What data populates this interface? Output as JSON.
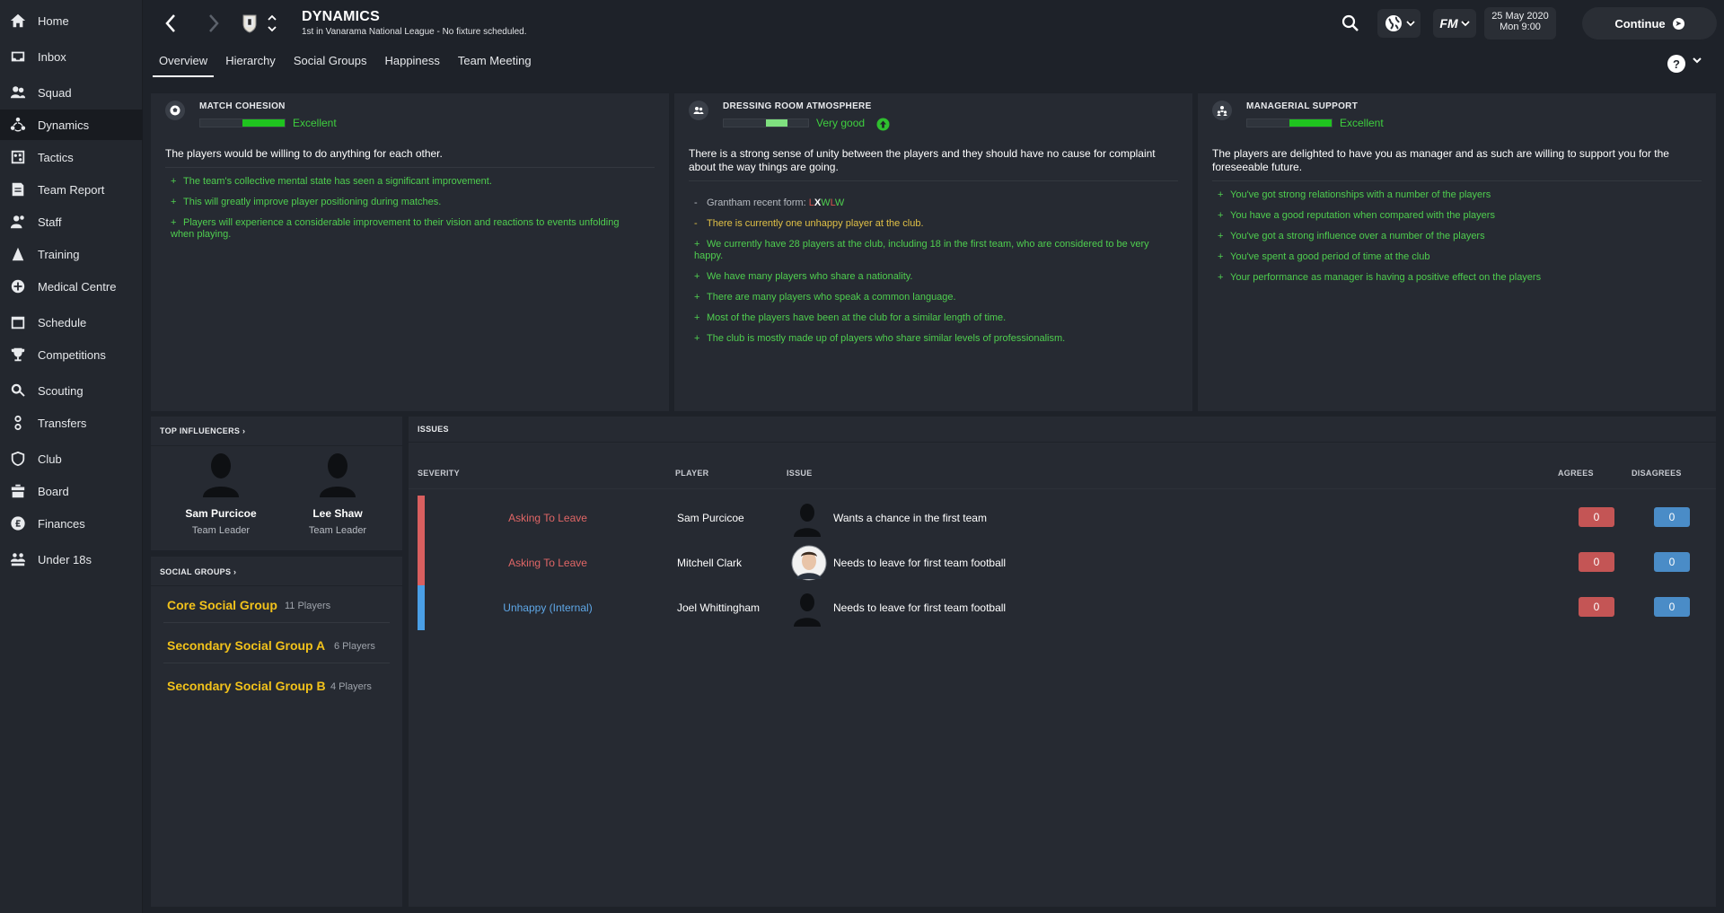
{
  "sidebar": {
    "items": [
      {
        "label": "Home",
        "icon": "home-icon",
        "active": false
      },
      {
        "label": "Inbox",
        "icon": "inbox-icon",
        "active": false
      },
      {
        "label": "Squad",
        "icon": "squad-icon",
        "active": false
      },
      {
        "label": "Dynamics",
        "icon": "dynamics-icon",
        "active": true
      },
      {
        "label": "Tactics",
        "icon": "tactics-icon",
        "active": false
      },
      {
        "label": "Team Report",
        "icon": "team-report-icon",
        "active": false
      },
      {
        "label": "Staff",
        "icon": "staff-icon",
        "active": false
      },
      {
        "label": "Training",
        "icon": "training-icon",
        "active": false
      },
      {
        "label": "Medical Centre",
        "icon": "medical-icon",
        "active": false
      },
      {
        "label": "Schedule",
        "icon": "schedule-icon",
        "active": false
      },
      {
        "label": "Competitions",
        "icon": "trophy-icon",
        "active": false
      },
      {
        "label": "Scouting",
        "icon": "search-icon",
        "active": false
      },
      {
        "label": "Transfers",
        "icon": "transfers-icon",
        "active": false
      },
      {
        "label": "Club",
        "icon": "club-shield-icon",
        "active": false
      },
      {
        "label": "Board",
        "icon": "board-icon",
        "active": false
      },
      {
        "label": "Finances",
        "icon": "finances-icon",
        "active": false
      },
      {
        "label": "Under 18s",
        "icon": "youth-icon",
        "active": false
      }
    ]
  },
  "header": {
    "title": "DYNAMICS",
    "subtitle": "1st in Vanarama National League - No fixture scheduled.",
    "fm_label": "FM",
    "date": "25 May 2020",
    "day_time": "Mon 9:00",
    "continue_label": "Continue"
  },
  "tabs": [
    {
      "label": "Overview",
      "active": true
    },
    {
      "label": "Hierarchy",
      "active": false
    },
    {
      "label": "Social Groups",
      "active": false
    },
    {
      "label": "Happiness",
      "active": false
    },
    {
      "label": "Team Meeting",
      "active": false
    }
  ],
  "help_label": "?",
  "cards": {
    "cohesion": {
      "title": "MATCH COHESION",
      "rating": "Excellent",
      "summary": "The players would be willing to do anything for each other.",
      "factors": [
        {
          "sym": "+",
          "text": "The team's collective mental state has seen a significant improvement.",
          "type": "pos"
        },
        {
          "sym": "+",
          "text": "This will greatly improve player positioning during matches.",
          "type": "pos"
        },
        {
          "sym": "+",
          "text": "Players will experience a considerable improvement to their vision and reactions to events unfolding when playing.",
          "type": "pos"
        }
      ]
    },
    "atmosphere": {
      "title": "DRESSING ROOM ATMOSPHERE",
      "rating": "Very good",
      "summary": "There is a strong sense of unity between the players and they should have no cause for complaint about the way things are going.",
      "form_label": "Grantham recent form: ",
      "form": [
        {
          "r": "L",
          "color": "#d9534f"
        },
        {
          "r": "X",
          "color": "#ffffff"
        },
        {
          "r": "W",
          "color": "#4fce4f"
        },
        {
          "r": "L",
          "color": "#d9534f"
        },
        {
          "r": "W",
          "color": "#4fce4f"
        }
      ],
      "factors": [
        {
          "sym": "-",
          "text": "There is currently one unhappy player at the club.",
          "type": "neg"
        },
        {
          "sym": "+",
          "text": "We currently have 28 players at the club, including 18 in the first team, who are considered to be very happy.",
          "type": "pos"
        },
        {
          "sym": "+",
          "text": "We have many players who share a nationality.",
          "type": "pos"
        },
        {
          "sym": "+",
          "text": "There are many players who speak a common language.",
          "type": "pos"
        },
        {
          "sym": "+",
          "text": "Most of the players have been at the club for a similar length of time.",
          "type": "pos"
        },
        {
          "sym": "+",
          "text": "The club is mostly made up of players who share similar levels of professionalism.",
          "type": "pos"
        }
      ]
    },
    "support": {
      "title": "MANAGERIAL SUPPORT",
      "rating": "Excellent",
      "summary": "The players are delighted to have you as manager and as such are willing to support you for the foreseeable future.",
      "factors": [
        {
          "sym": "+",
          "text": "You've got strong relationships with a number of the players",
          "type": "pos"
        },
        {
          "sym": "+",
          "text": "You have a good reputation when compared with the players",
          "type": "pos"
        },
        {
          "sym": "+",
          "text": "You've got a strong influence over a number of the players",
          "type": "pos"
        },
        {
          "sym": "+",
          "text": "You've spent a good period of time at the club",
          "type": "pos"
        },
        {
          "sym": "+",
          "text": "Your performance as manager is having a positive effect on the players",
          "type": "pos"
        }
      ]
    }
  },
  "influencers": {
    "title": "TOP INFLUENCERS",
    "people": [
      {
        "name": "Sam Purcicoe",
        "role": "Team Leader"
      },
      {
        "name": "Lee Shaw",
        "role": "Team Leader"
      }
    ]
  },
  "social_groups": {
    "title": "SOCIAL GROUPS",
    "groups": [
      {
        "name": "Core Social Group",
        "count": "11 Players"
      },
      {
        "name": "Secondary Social Group A",
        "count": "6 Players"
      },
      {
        "name": "Secondary Social Group B",
        "count": "4 Players"
      }
    ]
  },
  "issues": {
    "title": "ISSUES",
    "columns": {
      "severity": "SEVERITY",
      "player": "PLAYER",
      "issue": "ISSUE",
      "agrees": "AGREES",
      "disagrees": "DISAGREES"
    },
    "rows": [
      {
        "severity": "Asking To Leave",
        "sev_color": "#e06666",
        "bar_color": "#d95f5f",
        "player": "Sam Purcicoe",
        "issue": "Wants a chance in the first team",
        "agrees": "0",
        "disagrees": "0",
        "photo": false
      },
      {
        "severity": "Asking To Leave",
        "sev_color": "#e06666",
        "bar_color": "#d95f5f",
        "player": "Mitchell Clark",
        "issue": "Needs to leave for first team football",
        "agrees": "0",
        "disagrees": "0",
        "photo": true
      },
      {
        "severity": "Unhappy (Internal)",
        "sev_color": "#5fa8e8",
        "bar_color": "#4a9fe6",
        "player": "Joel Whittingham",
        "issue": "Needs to leave for first team football",
        "agrees": "0",
        "disagrees": "0",
        "photo": false
      }
    ]
  },
  "colors": {
    "positive": "#4fce4f",
    "warning": "#e0c046",
    "agree_badge": "#c45555",
    "disagree_badge": "#4a8cc7",
    "social_group": "#f2c21b"
  }
}
